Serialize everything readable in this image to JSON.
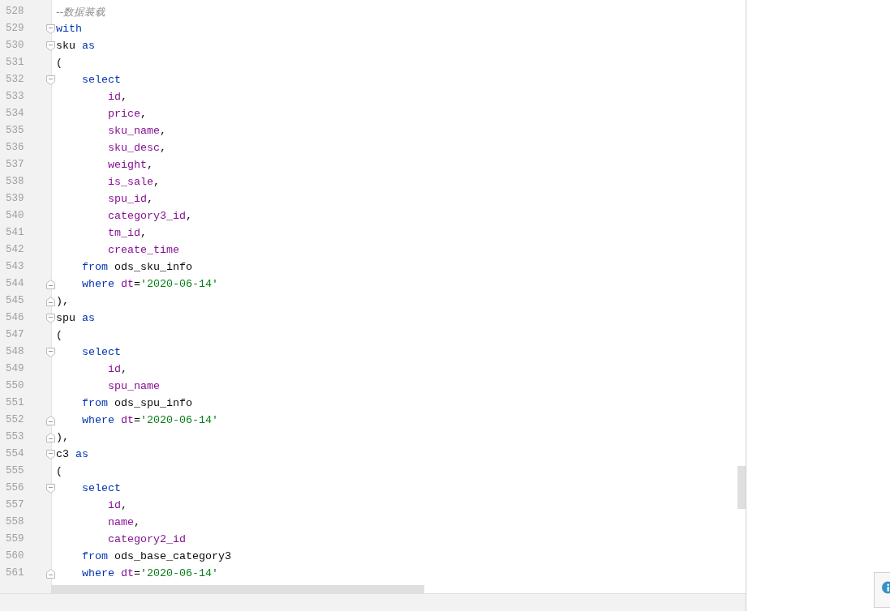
{
  "editor": {
    "lines": [
      {
        "number": "528",
        "block_start": false,
        "block_end": false,
        "tokens": [
          {
            "kind": "comment",
            "text": "--数据装载"
          }
        ]
      },
      {
        "number": "529",
        "block_start": true,
        "block_end": false,
        "tokens": [
          {
            "kind": "keyword",
            "text": "with"
          }
        ]
      },
      {
        "number": "530",
        "block_start": true,
        "block_end": false,
        "tokens": [
          {
            "kind": "plain",
            "text": "sku "
          },
          {
            "kind": "keyword",
            "text": "as"
          }
        ]
      },
      {
        "number": "531",
        "block_start": false,
        "block_end": false,
        "tokens": [
          {
            "kind": "plain",
            "text": "("
          }
        ]
      },
      {
        "number": "532",
        "block_start": true,
        "block_end": false,
        "tokens": [
          {
            "kind": "keyword",
            "text": "    select"
          }
        ]
      },
      {
        "number": "533",
        "block_start": false,
        "block_end": false,
        "tokens": [
          {
            "kind": "field",
            "text": "        id"
          },
          {
            "kind": "plain",
            "text": ","
          }
        ]
      },
      {
        "number": "534",
        "block_start": false,
        "block_end": false,
        "tokens": [
          {
            "kind": "field",
            "text": "        price"
          },
          {
            "kind": "plain",
            "text": ","
          }
        ]
      },
      {
        "number": "535",
        "block_start": false,
        "block_end": false,
        "tokens": [
          {
            "kind": "field",
            "text": "        sku_name"
          },
          {
            "kind": "plain",
            "text": ","
          }
        ]
      },
      {
        "number": "536",
        "block_start": false,
        "block_end": false,
        "tokens": [
          {
            "kind": "field",
            "text": "        sku_desc"
          },
          {
            "kind": "plain",
            "text": ","
          }
        ]
      },
      {
        "number": "537",
        "block_start": false,
        "block_end": false,
        "tokens": [
          {
            "kind": "field",
            "text": "        weight"
          },
          {
            "kind": "plain",
            "text": ","
          }
        ]
      },
      {
        "number": "538",
        "block_start": false,
        "block_end": false,
        "tokens": [
          {
            "kind": "field",
            "text": "        is_sale"
          },
          {
            "kind": "plain",
            "text": ","
          }
        ]
      },
      {
        "number": "539",
        "block_start": false,
        "block_end": false,
        "tokens": [
          {
            "kind": "field",
            "text": "        spu_id"
          },
          {
            "kind": "plain",
            "text": ","
          }
        ]
      },
      {
        "number": "540",
        "block_start": false,
        "block_end": false,
        "tokens": [
          {
            "kind": "field",
            "text": "        category3_id"
          },
          {
            "kind": "plain",
            "text": ","
          }
        ]
      },
      {
        "number": "541",
        "block_start": false,
        "block_end": false,
        "tokens": [
          {
            "kind": "field",
            "text": "        tm_id"
          },
          {
            "kind": "plain",
            "text": ","
          }
        ]
      },
      {
        "number": "542",
        "block_start": false,
        "block_end": false,
        "tokens": [
          {
            "kind": "field",
            "text": "        create_time"
          }
        ]
      },
      {
        "number": "543",
        "block_start": false,
        "block_end": false,
        "tokens": [
          {
            "kind": "keyword",
            "text": "    from"
          },
          {
            "kind": "plain",
            "text": " ods_sku_info"
          }
        ]
      },
      {
        "number": "544",
        "block_start": false,
        "block_end": true,
        "tokens": [
          {
            "kind": "keyword",
            "text": "    where"
          },
          {
            "kind": "field",
            "text": " dt"
          },
          {
            "kind": "plain",
            "text": "="
          },
          {
            "kind": "string",
            "text": "'2020-06-14'"
          }
        ]
      },
      {
        "number": "545",
        "block_start": false,
        "block_end": true,
        "tokens": [
          {
            "kind": "plain",
            "text": "),"
          }
        ]
      },
      {
        "number": "546",
        "block_start": true,
        "block_end": false,
        "tokens": [
          {
            "kind": "plain",
            "text": "spu "
          },
          {
            "kind": "keyword",
            "text": "as"
          }
        ]
      },
      {
        "number": "547",
        "block_start": false,
        "block_end": false,
        "tokens": [
          {
            "kind": "plain",
            "text": "("
          }
        ]
      },
      {
        "number": "548",
        "block_start": true,
        "block_end": false,
        "tokens": [
          {
            "kind": "keyword",
            "text": "    select"
          }
        ]
      },
      {
        "number": "549",
        "block_start": false,
        "block_end": false,
        "tokens": [
          {
            "kind": "field",
            "text": "        id"
          },
          {
            "kind": "plain",
            "text": ","
          }
        ]
      },
      {
        "number": "550",
        "block_start": false,
        "block_end": false,
        "tokens": [
          {
            "kind": "field",
            "text": "        spu_name"
          }
        ]
      },
      {
        "number": "551",
        "block_start": false,
        "block_end": false,
        "tokens": [
          {
            "kind": "keyword",
            "text": "    from"
          },
          {
            "kind": "plain",
            "text": " ods_spu_info"
          }
        ]
      },
      {
        "number": "552",
        "block_start": false,
        "block_end": true,
        "tokens": [
          {
            "kind": "keyword",
            "text": "    where"
          },
          {
            "kind": "field",
            "text": " dt"
          },
          {
            "kind": "plain",
            "text": "="
          },
          {
            "kind": "string",
            "text": "'2020-06-14'"
          }
        ]
      },
      {
        "number": "553",
        "block_start": false,
        "block_end": true,
        "tokens": [
          {
            "kind": "plain",
            "text": "),"
          }
        ]
      },
      {
        "number": "554",
        "block_start": true,
        "block_end": false,
        "tokens": [
          {
            "kind": "plain",
            "text": "c3 "
          },
          {
            "kind": "keyword",
            "text": "as"
          }
        ]
      },
      {
        "number": "555",
        "block_start": false,
        "block_end": false,
        "tokens": [
          {
            "kind": "plain",
            "text": "("
          }
        ]
      },
      {
        "number": "556",
        "block_start": true,
        "block_end": false,
        "tokens": [
          {
            "kind": "keyword",
            "text": "    select"
          }
        ]
      },
      {
        "number": "557",
        "block_start": false,
        "block_end": false,
        "tokens": [
          {
            "kind": "field",
            "text": "        id"
          },
          {
            "kind": "plain",
            "text": ","
          }
        ]
      },
      {
        "number": "558",
        "block_start": false,
        "block_end": false,
        "tokens": [
          {
            "kind": "field",
            "text": "        name"
          },
          {
            "kind": "plain",
            "text": ","
          }
        ]
      },
      {
        "number": "559",
        "block_start": false,
        "block_end": false,
        "tokens": [
          {
            "kind": "field",
            "text": "        category2_id"
          }
        ]
      },
      {
        "number": "560",
        "block_start": false,
        "block_end": false,
        "tokens": [
          {
            "kind": "keyword",
            "text": "    from"
          },
          {
            "kind": "plain",
            "text": " ods_base_category3"
          }
        ]
      },
      {
        "number": "561",
        "block_start": false,
        "block_end": true,
        "tokens": [
          {
            "kind": "keyword",
            "text": "    where"
          },
          {
            "kind": "field",
            "text": " dt"
          },
          {
            "kind": "plain",
            "text": "="
          },
          {
            "kind": "string",
            "text": "'2020-06-14'"
          }
        ]
      }
    ]
  }
}
